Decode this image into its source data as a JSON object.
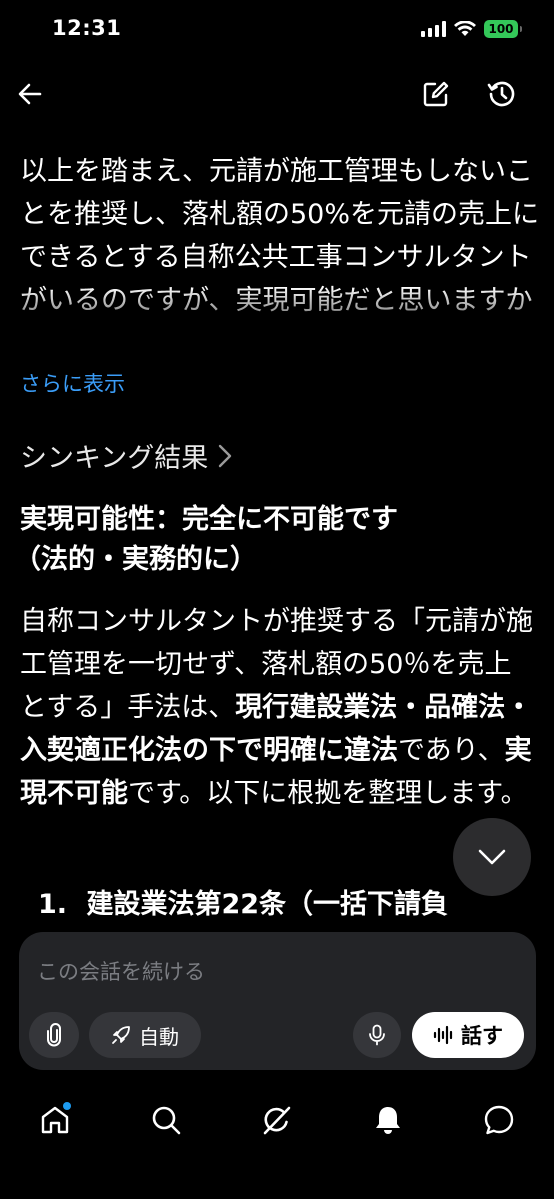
{
  "status": {
    "time": "12:31",
    "battery": "100"
  },
  "header": {
    "back": "back-arrow-icon",
    "edit": "edit-icon",
    "history": "history-icon"
  },
  "user_message": {
    "text": "以上を踏まえ、元請が施工管理もしないことを推奨し、落札額の50%を元請の売上にできるとする自称公共工事コンサルタントがいるのですが、実現可能だと思いますか",
    "show_more": "さらに表示"
  },
  "thinking": {
    "label": "シンキング結果",
    "chevron": "›"
  },
  "answer": {
    "heading_line1": "実現可能性：完全に不可能です",
    "heading_line2": "（法的・実務的に）",
    "p1": "自称コンサルタントが推奨する「元請が施工管理を一切せず、落札額の50％を売上とする」手法は、",
    "b1": "現行建設業法・品確法・入契適正化法の下で明確に違法",
    "p2": "であり、",
    "b2": "実現不可能",
    "p3": "です。以下に根拠を整理します。",
    "list_num": "1.",
    "list_text": "建設業法第22条（一括下請負"
  },
  "composer": {
    "placeholder": "この会話を続ける",
    "mode_label": "自動",
    "talk_label": "話す"
  },
  "colors": {
    "accent": "#3b9df7",
    "battery": "#34c759",
    "notification_dot": "#1d9bf0"
  }
}
